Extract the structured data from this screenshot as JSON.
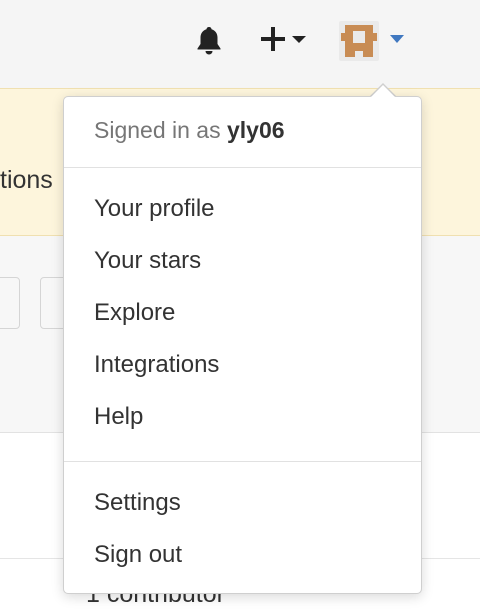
{
  "header": {
    "icons": [
      "bell-icon",
      "plus-icon",
      "chevron-down-icon",
      "avatar",
      "caret-down-icon"
    ]
  },
  "background": {
    "banner_fragment": "tions",
    "contributors_fragment": "1 contributor"
  },
  "dropdown": {
    "signed_in_prefix": "Signed in as",
    "username": "yly06",
    "items": [
      {
        "label": "Your profile"
      },
      {
        "label": "Your stars"
      },
      {
        "label": "Explore"
      },
      {
        "label": "Integrations"
      },
      {
        "label": "Help"
      }
    ],
    "footer_items": [
      {
        "label": "Settings"
      },
      {
        "label": "Sign out"
      }
    ]
  },
  "colors": {
    "accent": "#4078c0",
    "avatar": "#c88c54",
    "banner": "#fdf5dc"
  }
}
